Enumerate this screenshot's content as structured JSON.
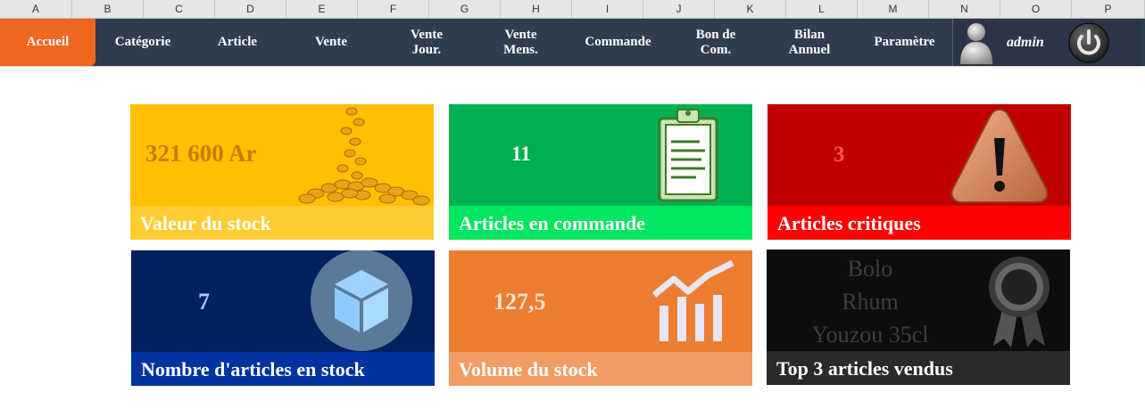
{
  "columns": [
    "A",
    "B",
    "C",
    "D",
    "E",
    "F",
    "G",
    "H",
    "I",
    "J",
    "K",
    "L",
    "M",
    "N",
    "O",
    "P"
  ],
  "nav": {
    "items": [
      {
        "l1": "Accueil",
        "l2": ""
      },
      {
        "l1": "Catégorie",
        "l2": ""
      },
      {
        "l1": "Article",
        "l2": ""
      },
      {
        "l1": "Vente",
        "l2": ""
      },
      {
        "l1": "Vente",
        "l2": "Jour."
      },
      {
        "l1": "Vente",
        "l2": "Mens."
      },
      {
        "l1": "Commande",
        "l2": ""
      },
      {
        "l1": "Bon de",
        "l2": "Com."
      },
      {
        "l1": "Bilan",
        "l2": "Annuel"
      },
      {
        "l1": "Paramètre",
        "l2": ""
      }
    ],
    "active_index": 0
  },
  "user": {
    "name": "admin"
  },
  "tiles": {
    "stock_value": {
      "value": "321 600 Ar",
      "caption": "Valeur du stock"
    },
    "orders": {
      "value": "11",
      "caption": "Articles en commande"
    },
    "critical": {
      "value": "3",
      "caption": "Articles critiques"
    },
    "in_stock": {
      "value": "7",
      "caption": "Nombre d'articles en stock"
    },
    "volume": {
      "value": "127,5",
      "caption": "Volume du stock"
    },
    "top3": {
      "items": [
        "Bolo",
        "Rhum",
        "Youzou 35cl"
      ],
      "caption": "Top 3 articles vendus"
    }
  },
  "colors": {
    "nav_bg": "#2f3d4f",
    "active": "#f0661e",
    "yellow": "#ffc000",
    "green": "#00b050",
    "red": "#c00000",
    "navy": "#002060",
    "orange": "#ed7d31",
    "black": "#0d0d0d"
  }
}
